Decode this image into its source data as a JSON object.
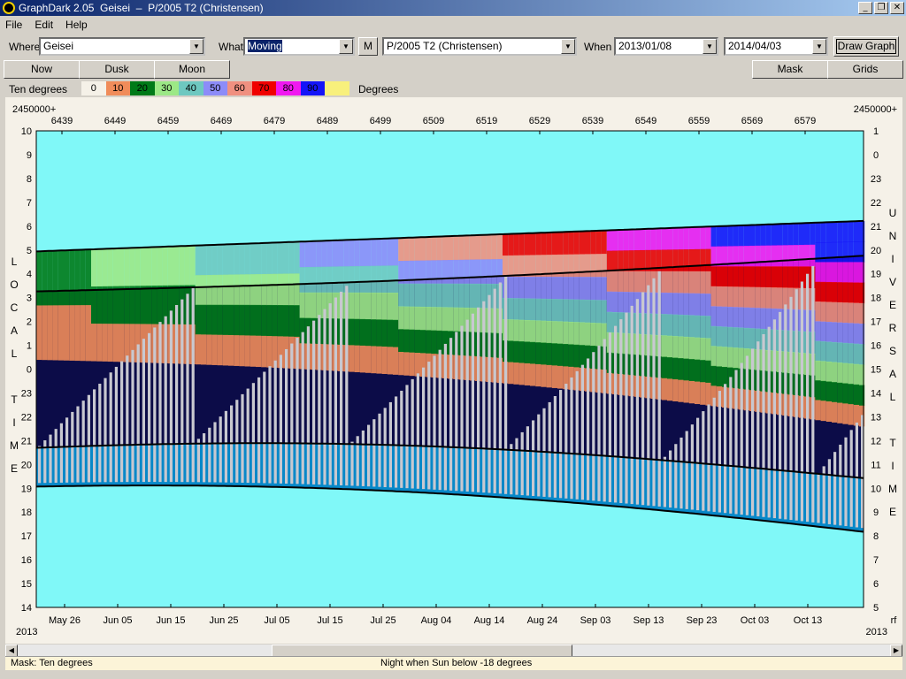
{
  "window": {
    "title": "GraphDark 2.05  Geisei  –  P/2005 T2 (Christensen)",
    "minimize": "_",
    "restore": "❐",
    "close": "✕"
  },
  "menu": [
    "File",
    "Edit",
    "Help"
  ],
  "toolbar": {
    "where_label": "Where",
    "where_value": "Geisei",
    "what_label": "What",
    "what_value": "Moving",
    "m_button": "M",
    "object_value": "P/2005 T2 (Christensen)",
    "when_label": "When",
    "start_date": "2013/01/08",
    "end_date": "2014/04/03",
    "draw_button": "Draw Graph"
  },
  "buttons": {
    "now": "Now",
    "dusk": "Dusk",
    "moon": "Moon",
    "mask": "Mask",
    "grids": "Grids"
  },
  "legend": {
    "label": "Ten degrees",
    "unit": "Degrees",
    "items": [
      {
        "label": "0",
        "color": "#f5f1e8"
      },
      {
        "label": "10",
        "color": "#f08c5a"
      },
      {
        "label": "20",
        "color": "#007a18"
      },
      {
        "label": "30",
        "color": "#9ce886"
      },
      {
        "label": "40",
        "color": "#6ec8c0"
      },
      {
        "label": "50",
        "color": "#8c8cf8"
      },
      {
        "label": "60",
        "color": "#f09080"
      },
      {
        "label": "70",
        "color": "#f00000"
      },
      {
        "label": "80",
        "color": "#f018f0"
      },
      {
        "label": "90",
        "color": "#1414f8"
      },
      {
        "label": "",
        "color": "#f8f07c"
      }
    ]
  },
  "plot": {
    "jd_prefix_left": "2450000+",
    "jd_prefix_right": "2450000+",
    "jd_ticks": [
      "6439",
      "6449",
      "6459",
      "6469",
      "6479",
      "6489",
      "6499",
      "6509",
      "6519",
      "6529",
      "6539",
      "6549",
      "6559",
      "6569",
      "6579"
    ],
    "date_ticks": [
      "May 26",
      "Jun 05",
      "Jun 15",
      "Jun 25",
      "Jul 05",
      "Jul 15",
      "Jul 25",
      "Aug 04",
      "Aug 14",
      "Aug 24",
      "Sep 03",
      "Sep 13",
      "Sep 23",
      "Oct 03",
      "Oct 13"
    ],
    "year_left": "2013",
    "year_right": "2013",
    "right_corner": "rf",
    "local_hours": [
      "10",
      "9",
      "8",
      "7",
      "6",
      "5",
      "4",
      "3",
      "2",
      "1",
      "0",
      "23",
      "22",
      "21",
      "20",
      "19",
      "18",
      "17",
      "16",
      "15",
      "14"
    ],
    "universal_hours": [
      "1",
      "0",
      "23",
      "22",
      "21",
      "20",
      "19",
      "18",
      "17",
      "16",
      "15",
      "14",
      "13",
      "12",
      "11",
      "10",
      "9",
      "8",
      "7",
      "6",
      "5"
    ],
    "local_label": [
      "L",
      "O",
      "C",
      "A",
      "L",
      "",
      "T",
      "I",
      "M",
      "E"
    ],
    "universal_label": [
      "U",
      "N",
      "I",
      "V",
      "E",
      "R",
      "S",
      "A",
      "L",
      "",
      "T",
      "I",
      "M",
      "E"
    ],
    "colors": {
      "sky": "#80f8f8",
      "night": "#0c0c48",
      "twilight": "#0888c8",
      "moonbar": "#c8c8d0",
      "curve": "#000000"
    }
  },
  "status": {
    "mask": "Mask:  Ten degrees",
    "night": "Night when Sun below -18 degrees"
  }
}
